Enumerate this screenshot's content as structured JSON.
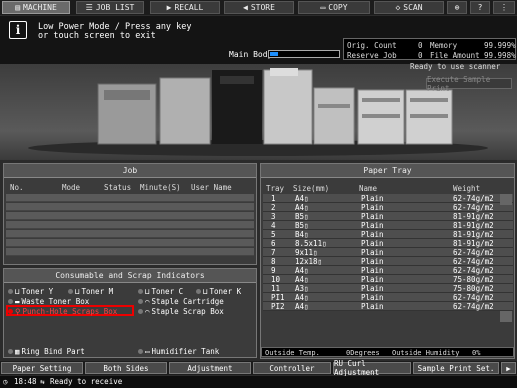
{
  "tabs": [
    {
      "label": "MACHINE",
      "icon": "printer-icon"
    },
    {
      "label": "JOB LIST",
      "icon": "list-icon"
    },
    {
      "label": "RECALL",
      "icon": "recall-icon"
    },
    {
      "label": "STORE",
      "icon": "store-icon"
    },
    {
      "label": "COPY",
      "icon": "copy-icon"
    },
    {
      "label": "SCAN",
      "icon": "scan-icon"
    }
  ],
  "message": {
    "line1": "Low Power Mode / Press any key",
    "line2": "or touch screen to exit"
  },
  "main_body": {
    "label": "Main Body",
    "level": 0.12
  },
  "counters": {
    "orig_count_label": "Orig. Count",
    "orig_count": "0",
    "memory_label": "Memory",
    "memory": "99.999%",
    "reserve_job_label": "Reserve Job",
    "reserve_job": "0",
    "file_amount_label": "File Amount",
    "file_amount": "99.998%"
  },
  "status_msg": "Ready to use scanner",
  "sample_button": "Execute Sample Print",
  "job": {
    "title": "Job",
    "columns": [
      "No.",
      "Mode",
      "Status",
      "Minute(S)",
      "User Name"
    ]
  },
  "consumables": {
    "title": "Consumable and Scrap Indicators",
    "items": [
      "Toner Y",
      "Toner M",
      "Toner C",
      "Toner K",
      "Waste Toner Box",
      "Staple Cartridge",
      "Punch-Hole Scraps Box",
      "Staple Scrap Box",
      "Ring Bind Part",
      "Humidifier Tank"
    ]
  },
  "tray": {
    "title": "Paper Tray",
    "columns": [
      "Tray",
      "Size(mm)",
      "Name",
      "Weight"
    ],
    "rows": [
      [
        "1",
        "A4▯",
        "Plain",
        "62-74g/m2"
      ],
      [
        "2",
        "A4▯",
        "Plain",
        "62-74g/m2"
      ],
      [
        "3",
        "B5▯",
        "Plain",
        "81-91g/m2"
      ],
      [
        "4",
        "B5▯",
        "Plain",
        "81-91g/m2"
      ],
      [
        "5",
        "B4▯",
        "Plain",
        "81-91g/m2"
      ],
      [
        "6",
        "8.5x11▯",
        "Plain",
        "81-91g/m2"
      ],
      [
        "7",
        "9x11▯",
        "Plain",
        "62-74g/m2"
      ],
      [
        "8",
        "12x18▯",
        "Plain",
        "62-74g/m2"
      ],
      [
        "9",
        "A4▯",
        "Plain",
        "62-74g/m2"
      ],
      [
        "10",
        "A4▯",
        "Plain",
        "75-80g/m2"
      ],
      [
        "11",
        "A3▯",
        "Plain",
        "75-80g/m2"
      ],
      [
        "PI1",
        "A4▯",
        "Plain",
        "62-74g/m2"
      ],
      [
        "PI2",
        "A4▯",
        "Plain",
        "62-74g/m2"
      ]
    ]
  },
  "outside": {
    "temp_label": "Outside Temp.",
    "temp": "0Degrees",
    "hum_label": "Outside Humidity",
    "hum": "0%"
  },
  "buttons": [
    "Paper Setting",
    "Both Sides",
    "Adjustment",
    "Controller",
    "RU Curl Adjustment",
    "Sample Print Set."
  ],
  "statusbar": {
    "time": "18:48",
    "text": "Ready to receive"
  },
  "colors": {
    "accent": "#1e90ff",
    "highlight": "#e00000"
  }
}
